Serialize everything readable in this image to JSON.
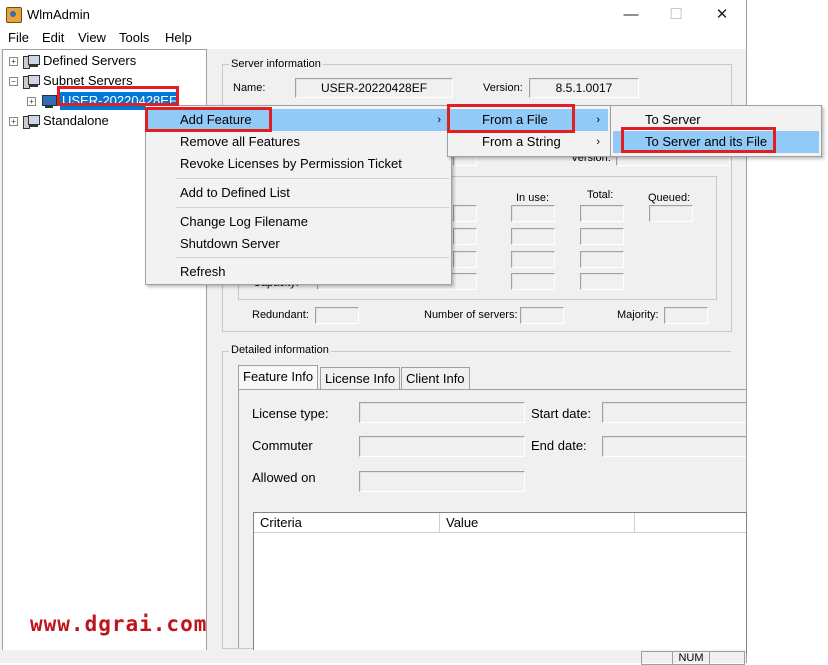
{
  "window": {
    "title": "WlmAdmin",
    "minimize": "—",
    "maximize": "☐",
    "close": "✕"
  },
  "menubar": [
    "File",
    "Edit",
    "View",
    "Tools",
    "Help"
  ],
  "tree": {
    "defined_servers": "Defined Servers",
    "subnet_servers": "Subnet Servers",
    "selected_host": "USER-20220428EF",
    "standalone": "Standalone"
  },
  "server_info": {
    "group_title": "Server information",
    "name_label": "Name:",
    "name_value": "USER-20220428EF",
    "version_label": "Version:",
    "version_value": "8.5.1.0017",
    "version2_label": "Version:",
    "in_use_label": "In use:",
    "total_label": "Total:",
    "queued_label": "Queued:",
    "capacity_label": "Capacity:",
    "redundant_label": "Redundant:",
    "num_servers_label": "Number of servers:",
    "majority_label": "Majority:"
  },
  "detailed_info": {
    "group_title": "Detailed information",
    "tabs": [
      "Feature Info",
      "License Info",
      "Client Info"
    ],
    "license_type_label": "License type:",
    "start_date_label": "Start date:",
    "commuter_label": "Commuter",
    "end_date_label": "End date:",
    "allowed_on_label": "Allowed on",
    "table_headers": [
      "Criteria",
      "Value",
      ""
    ]
  },
  "context_menu": {
    "items": [
      "Add Feature",
      "Remove all Features",
      "Revoke Licenses by Permission Ticket",
      "Add to Defined List",
      "Change Log Filename",
      "Shutdown Server",
      "Refresh"
    ]
  },
  "submenu_add_feature": [
    "From a File",
    "From a String"
  ],
  "submenu_from_file": [
    "To Server",
    "To Server and its File"
  ],
  "statusbar": {
    "num": "NUM"
  },
  "watermark": "www.dgrai.com",
  "colors": {
    "highlight": "#91c9f7",
    "selection": "#0078d7",
    "annotation": "#e02020"
  }
}
